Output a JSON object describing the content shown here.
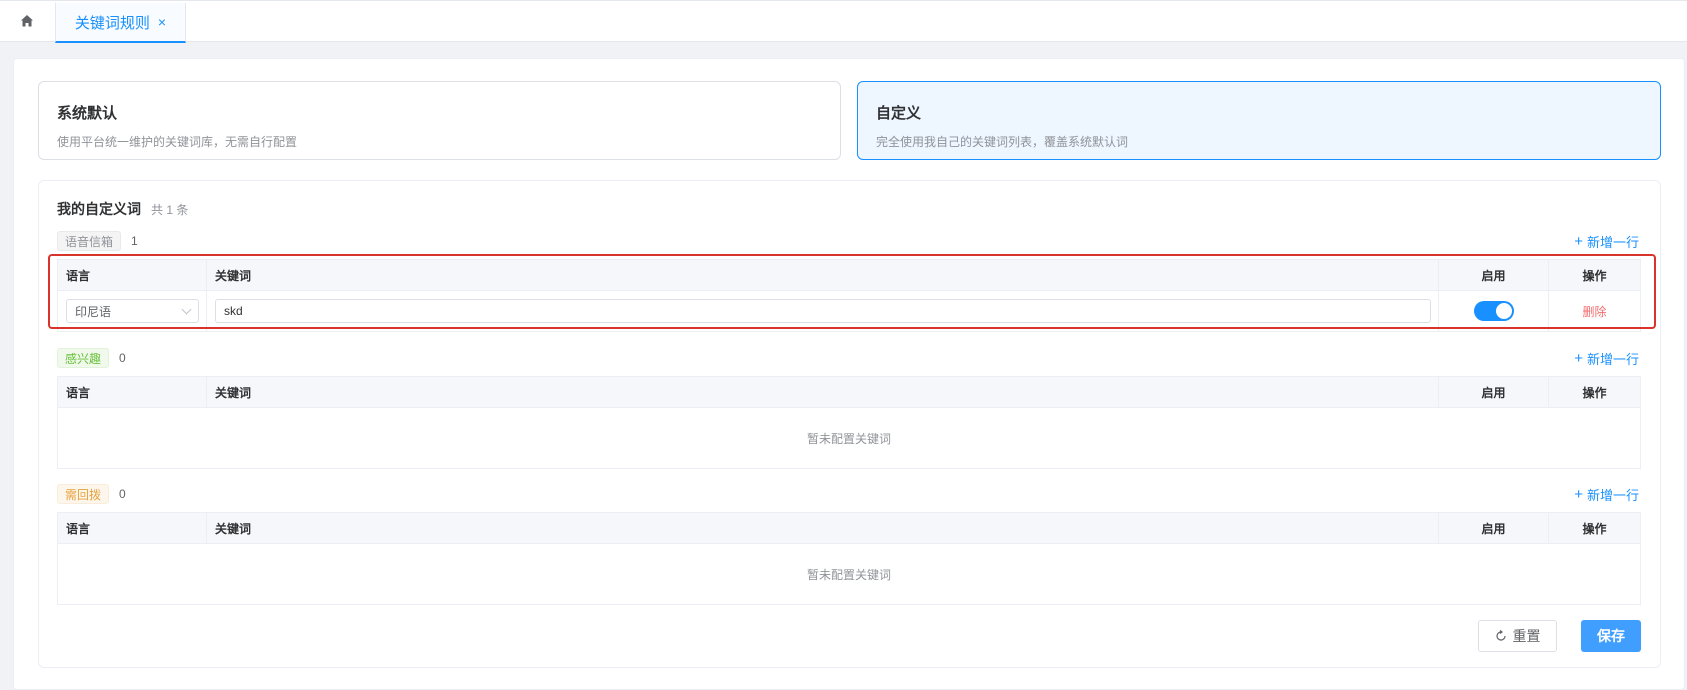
{
  "tabs": {
    "home_icon": "home-icon",
    "active": {
      "label": "关键词规则",
      "close": "×"
    }
  },
  "modes": {
    "system": {
      "title": "系统默认",
      "desc": "使用平台统一维护的关键词库，无需自行配置"
    },
    "custom": {
      "title": "自定义",
      "desc": "完全使用我自己的关键词列表，覆盖系统默认词"
    }
  },
  "list": {
    "title": "我的自定义词",
    "count": "共 1 条"
  },
  "columns": {
    "lang": "语言",
    "keyword": "关键词",
    "enabled": "启用",
    "action": "操作"
  },
  "add_row_label": "新增一行",
  "empty_text": "暂未配置关键词",
  "groups": [
    {
      "tag": "语音信箱",
      "count": "1",
      "rows": [
        {
          "lang": "印尼语",
          "keyword": "skd",
          "enabled": true,
          "delete": "删除"
        }
      ]
    },
    {
      "tag": "感兴趣",
      "count": "0",
      "rows": []
    },
    {
      "tag": "需回拨",
      "count": "0",
      "rows": []
    }
  ],
  "footer": {
    "reset": "重置",
    "save": "保存"
  },
  "colors": {
    "primary": "#1890ff",
    "danger": "#f56c6c",
    "highlight": "#d9342b"
  }
}
